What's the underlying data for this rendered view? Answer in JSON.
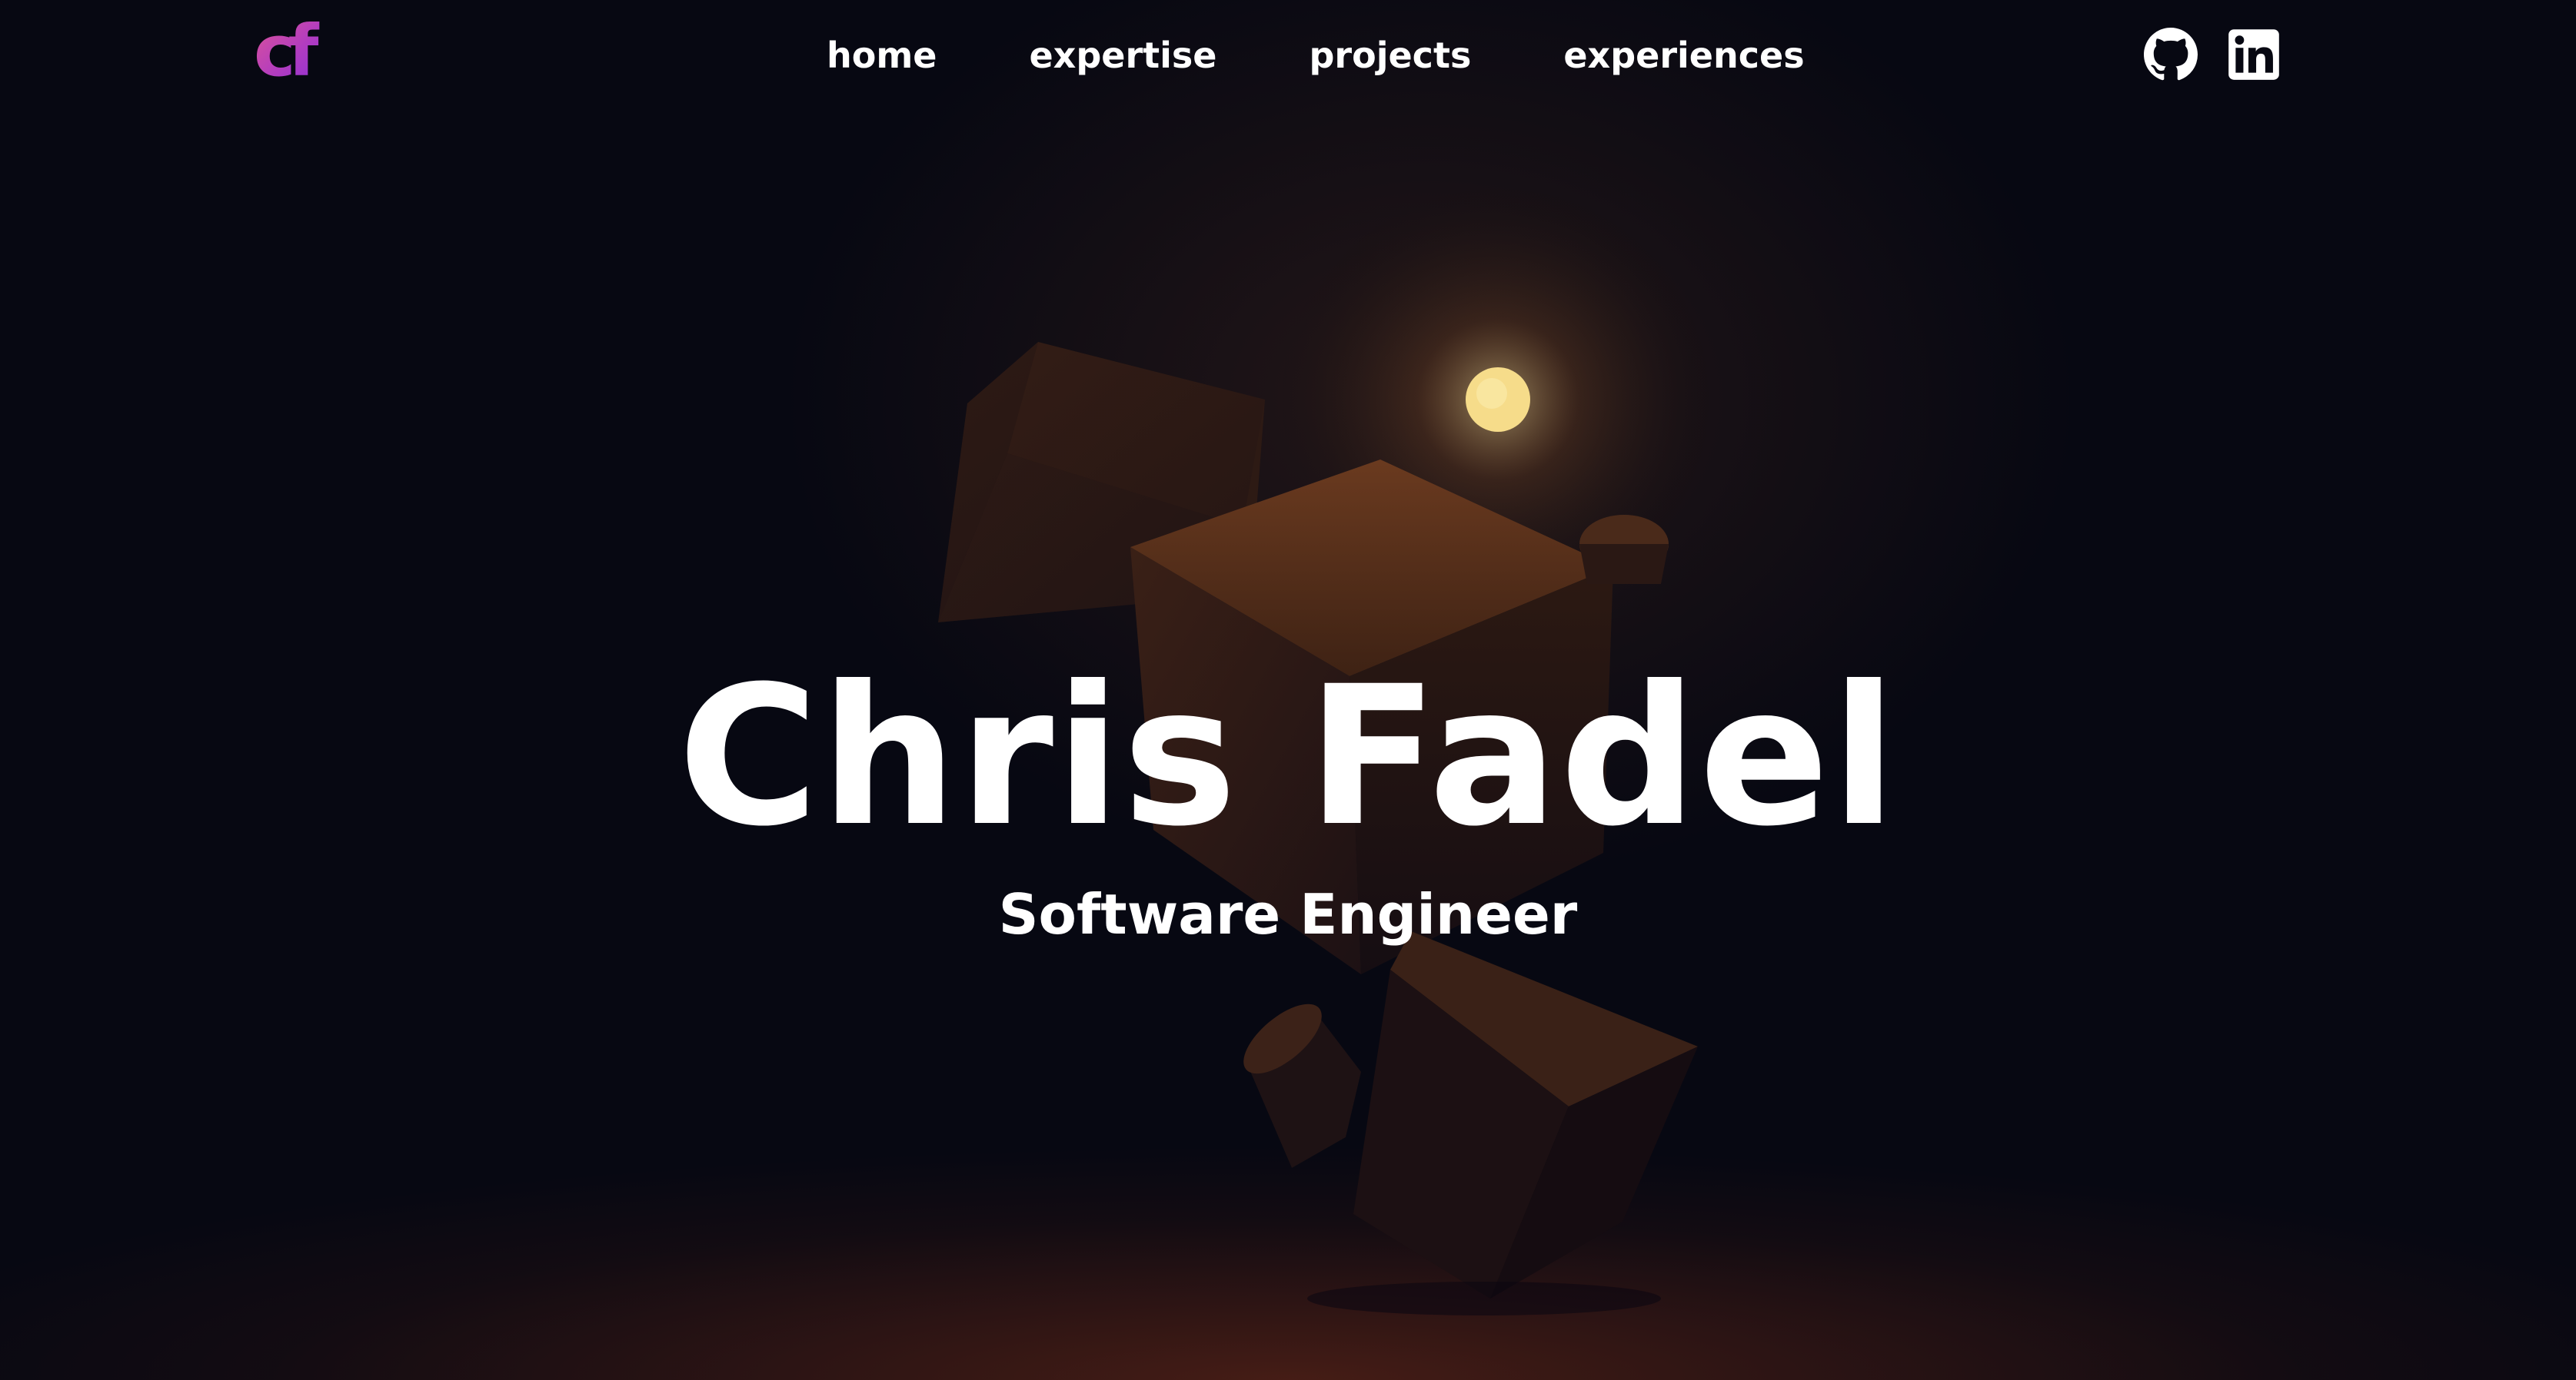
{
  "header": {
    "logo_text": "cf",
    "logo_colors": [
      "#e05596",
      "#8a2fd8"
    ],
    "nav": [
      {
        "label": "home"
      },
      {
        "label": "expertise"
      },
      {
        "label": "projects"
      },
      {
        "label": "experiences"
      }
    ],
    "social": [
      {
        "icon": "github-icon"
      },
      {
        "icon": "linkedin-icon"
      }
    ]
  },
  "hero": {
    "name": "Chris Fadel",
    "role": "Software Engineer"
  },
  "colors": {
    "background": "#070812",
    "text": "#ffffff",
    "light": "#f6dc8a",
    "cube": "#3a2218"
  }
}
